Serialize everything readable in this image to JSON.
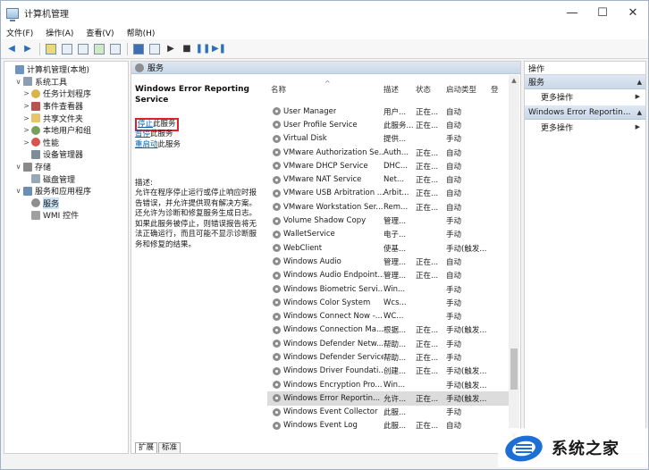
{
  "window": {
    "title": "计算机管理",
    "controls": [
      "—",
      "☐",
      "✕"
    ]
  },
  "menu": [
    "文件(F)",
    "操作(A)",
    "查看(V)",
    "帮助(H)"
  ],
  "tree": [
    {
      "label": "计算机管理(本地)",
      "indent": 0,
      "arrow": "",
      "icon": "computer"
    },
    {
      "label": "系统工具",
      "indent": 1,
      "arrow": "∨",
      "icon": "tools"
    },
    {
      "label": "任务计划程序",
      "indent": 2,
      "arrow": ">",
      "icon": "clock"
    },
    {
      "label": "事件查看器",
      "indent": 2,
      "arrow": ">",
      "icon": "event"
    },
    {
      "label": "共享文件夹",
      "indent": 2,
      "arrow": ">",
      "icon": "folder"
    },
    {
      "label": "本地用户和组",
      "indent": 2,
      "arrow": ">",
      "icon": "users"
    },
    {
      "label": "性能",
      "indent": 2,
      "arrow": ">",
      "icon": "perf"
    },
    {
      "label": "设备管理器",
      "indent": 2,
      "arrow": "",
      "icon": "device"
    },
    {
      "label": "存储",
      "indent": 1,
      "arrow": "∨",
      "icon": "storage"
    },
    {
      "label": "磁盘管理",
      "indent": 2,
      "arrow": "",
      "icon": "disk"
    },
    {
      "label": "服务和应用程序",
      "indent": 1,
      "arrow": "∨",
      "icon": "apps"
    },
    {
      "label": "服务",
      "indent": 2,
      "arrow": "",
      "icon": "gear",
      "selected": true
    },
    {
      "label": "WMI 控件",
      "indent": 2,
      "arrow": "",
      "icon": "wmi"
    }
  ],
  "center": {
    "header": "服务",
    "detail": {
      "title": "Windows Error Reporting Service",
      "stop_link": "停止",
      "stop_rest": "此服务",
      "pause_link": "暂停",
      "pause_rest": "此服务",
      "restart_link": "重启动",
      "restart_rest": "此服务",
      "desc_label": "描述:",
      "desc_text": "允许在程序停止运行或停止响应时报告错误，并允许提供现有解决方案。还允许为诊断和修复服务生成日志。如果此服务被停止，则错误报告将无法正确运行，而且可能不显示诊断服务和修复的结果。"
    },
    "columns": [
      "名称",
      "描述",
      "状态",
      "启动类型",
      "登"
    ],
    "rows": [
      {
        "name": "User Manager",
        "desc": "用户...",
        "status": "正在...",
        "start": "自动"
      },
      {
        "name": "User Profile Service",
        "desc": "此服务...",
        "status": "正在...",
        "start": "自动"
      },
      {
        "name": "Virtual Disk",
        "desc": "提供...",
        "status": "",
        "start": "手动"
      },
      {
        "name": "VMware Authorization Se...",
        "desc": "Auth...",
        "status": "正在...",
        "start": "自动"
      },
      {
        "name": "VMware DHCP Service",
        "desc": "DHC...",
        "status": "正在...",
        "start": "自动"
      },
      {
        "name": "VMware NAT Service",
        "desc": "Net...",
        "status": "正在...",
        "start": "自动"
      },
      {
        "name": "VMware USB Arbitration ...",
        "desc": "Arbit...",
        "status": "正在...",
        "start": "自动"
      },
      {
        "name": "VMware Workstation Ser...",
        "desc": "Rem...",
        "status": "正在...",
        "start": "自动"
      },
      {
        "name": "Volume Shadow Copy",
        "desc": "管理...",
        "status": "",
        "start": "手动"
      },
      {
        "name": "WalletService",
        "desc": "电子...",
        "status": "",
        "start": "手动"
      },
      {
        "name": "WebClient",
        "desc": "使基...",
        "status": "",
        "start": "手动(触发..."
      },
      {
        "name": "Windows Audio",
        "desc": "管理...",
        "status": "正在...",
        "start": "自动"
      },
      {
        "name": "Windows Audio Endpoint...",
        "desc": "管理...",
        "status": "正在...",
        "start": "自动"
      },
      {
        "name": "Windows Biometric Servi...",
        "desc": "Win...",
        "status": "",
        "start": "手动"
      },
      {
        "name": "Windows Color System",
        "desc": "Wcs...",
        "status": "",
        "start": "手动"
      },
      {
        "name": "Windows Connect Now -...",
        "desc": "WC...",
        "status": "",
        "start": "手动"
      },
      {
        "name": "Windows Connection Ma...",
        "desc": "根据...",
        "status": "正在...",
        "start": "手动(触发..."
      },
      {
        "name": "Windows Defender Netw...",
        "desc": "帮助...",
        "status": "正在...",
        "start": "手动"
      },
      {
        "name": "Windows Defender Service",
        "desc": "帮助...",
        "status": "正在...",
        "start": "手动"
      },
      {
        "name": "Windows Driver Foundati...",
        "desc": "创建...",
        "status": "正在...",
        "start": "手动(触发..."
      },
      {
        "name": "Windows Encryption Pro...",
        "desc": "Win...",
        "status": "",
        "start": "手动(触发..."
      },
      {
        "name": "Windows Error Reportin...",
        "desc": "允许...",
        "status": "正在...",
        "start": "手动(触发...",
        "selected": true
      },
      {
        "name": "Windows Event Collector",
        "desc": "此服...",
        "status": "",
        "start": "手动"
      },
      {
        "name": "Windows Event Log",
        "desc": "此服...",
        "status": "正在...",
        "start": "自动"
      }
    ],
    "tabs": [
      "扩展",
      "标准"
    ]
  },
  "actions": {
    "header": "操作",
    "sections": [
      {
        "title": "服务",
        "item": "更多操作"
      },
      {
        "title": "Windows Error Reportin...",
        "item": "更多操作"
      }
    ]
  },
  "watermark": "系统之家",
  "colors": {
    "accent": "#1d6fd6",
    "highlight_border": "#e0202a",
    "link": "#0b5cad"
  }
}
